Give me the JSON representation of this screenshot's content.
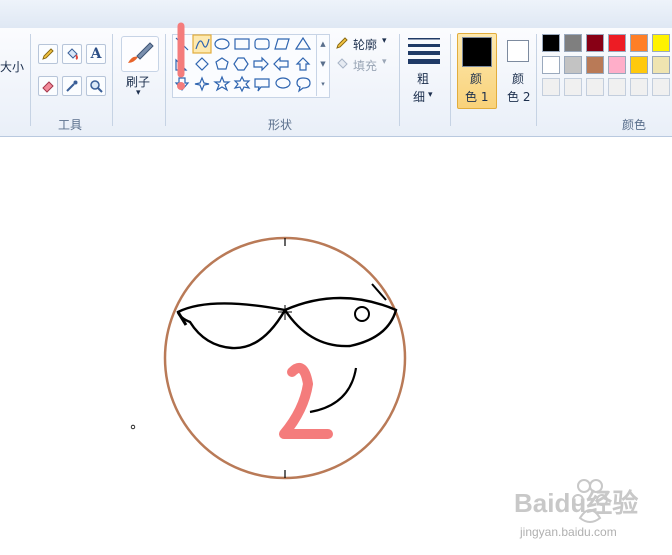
{
  "toolbar": {
    "size_label": "大小",
    "tools_group_label": "工具",
    "brush_label": "刷子",
    "shapes_group_label": "形状",
    "outline_label": "轮廓",
    "fill_label": "填充",
    "thickness_label_1": "粗",
    "thickness_label_2": "细",
    "color1_label_1": "颜",
    "color1_label_2": "色 1",
    "color2_label_1": "颜",
    "color2_label_2": "色 2",
    "colors_group_label": "颜色"
  },
  "palette": {
    "row1": [
      "#000000",
      "#7f7f7f",
      "#880015",
      "#ed1c24",
      "#ff7f27",
      "#fff200"
    ],
    "row2": [
      "#ffffff",
      "#c3c3c3",
      "#b97a57",
      "#ffaec9",
      "#ffc90e",
      "#efe4b0"
    ],
    "row3": [
      "#f0f0f0",
      "#f0f0f0",
      "#f0f0f0",
      "#f0f0f0",
      "#f0f0f0",
      "#f0f0f0"
    ]
  },
  "current_colors": {
    "color1": "#000000",
    "color2": "#ffffff"
  },
  "drawing": {
    "circle_color": "#b97a57",
    "number_text": "2",
    "number_color": "#f47c7c",
    "annotation_color": "#f47c7c"
  },
  "watermark": {
    "text": "Baidu经验",
    "subtext": "jingyan.baidu.com"
  }
}
